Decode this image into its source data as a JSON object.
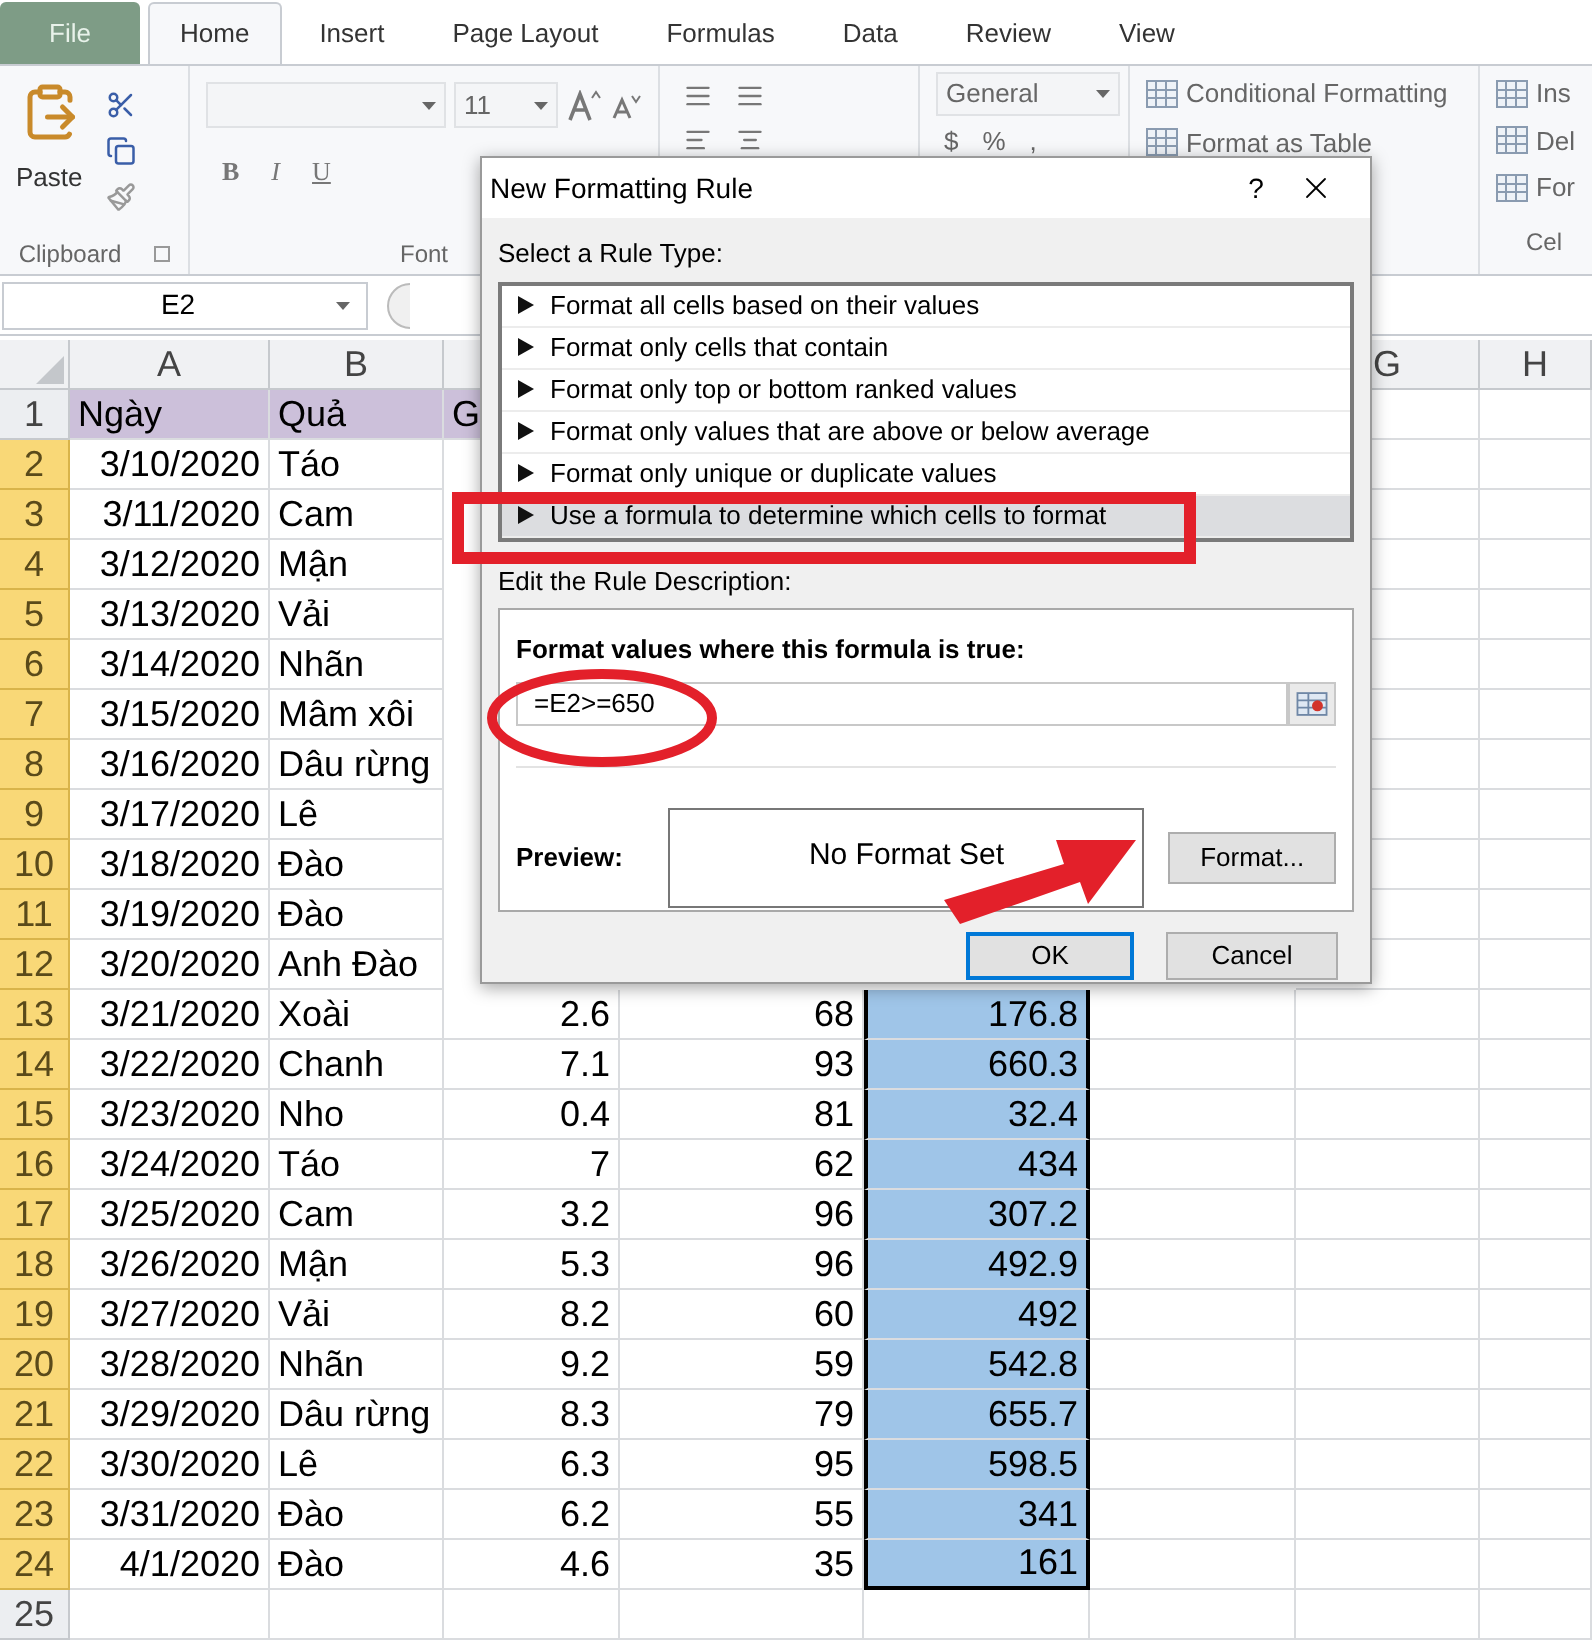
{
  "ribbon_tabs": [
    {
      "label": "File",
      "kind": "file",
      "selected": false
    },
    {
      "label": "Home",
      "kind": "tab",
      "selected": true
    },
    {
      "label": "Insert",
      "kind": "tab",
      "selected": false
    },
    {
      "label": "Page Layout",
      "kind": "tab",
      "selected": false
    },
    {
      "label": "Formulas",
      "kind": "tab",
      "selected": false
    },
    {
      "label": "Data",
      "kind": "tab",
      "selected": false
    },
    {
      "label": "Review",
      "kind": "tab",
      "selected": false
    },
    {
      "label": "View",
      "kind": "tab",
      "selected": false
    }
  ],
  "ribbon": {
    "clipboard": {
      "paste": "Paste",
      "group": "Clipboard"
    },
    "font": {
      "size": "11",
      "bold": "B",
      "italic": "I",
      "underline": "U",
      "group": "Font"
    },
    "number": {
      "format": "General",
      "currency": "$",
      "percent": "%",
      "comma": ","
    },
    "styles": {
      "conditional_formatting": "Conditional Formatting",
      "format_as_table": "Format as Table"
    },
    "cells": {
      "insert": "Ins",
      "delete": "Del",
      "format": "For",
      "group": "Cel"
    }
  },
  "name_box": "E2",
  "sheet": {
    "column_headers_left": [
      "A",
      "B"
    ],
    "column_headers_right": [
      "G",
      "H"
    ],
    "rows": [
      {
        "header": "1",
        "kind": "title",
        "selected": false,
        "cells": [
          "Ngày",
          "Quả",
          "G"
        ]
      },
      {
        "header": "2",
        "kind": "data",
        "selected": true,
        "cells": [
          "3/10/2020",
          "Táo"
        ]
      },
      {
        "header": "3",
        "kind": "data",
        "selected": true,
        "cells": [
          "3/11/2020",
          "Cam"
        ]
      },
      {
        "header": "4",
        "kind": "data",
        "selected": true,
        "cells": [
          "3/12/2020",
          "Mận"
        ]
      },
      {
        "header": "5",
        "kind": "data",
        "selected": true,
        "cells": [
          "3/13/2020",
          "Vải"
        ]
      },
      {
        "header": "6",
        "kind": "data",
        "selected": true,
        "cells": [
          "3/14/2020",
          "Nhãn"
        ]
      },
      {
        "header": "7",
        "kind": "data",
        "selected": true,
        "cells": [
          "3/15/2020",
          "Mâm xôi"
        ]
      },
      {
        "header": "8",
        "kind": "data",
        "selected": true,
        "cells": [
          "3/16/2020",
          "Dâu rừng"
        ]
      },
      {
        "header": "9",
        "kind": "data",
        "selected": true,
        "cells": [
          "3/17/2020",
          "Lê"
        ]
      },
      {
        "header": "10",
        "kind": "data",
        "selected": true,
        "cells": [
          "3/18/2020",
          "Đào"
        ]
      },
      {
        "header": "11",
        "kind": "data",
        "selected": true,
        "cells": [
          "3/19/2020",
          "Đào"
        ]
      },
      {
        "header": "12",
        "kind": "data",
        "selected": true,
        "cells": [
          "3/20/2020",
          "Anh Đào"
        ]
      },
      {
        "header": "13",
        "kind": "data",
        "selected": true,
        "cells": [
          "3/21/2020",
          "Xoài",
          "2.6",
          "68",
          "176.8"
        ]
      },
      {
        "header": "14",
        "kind": "data",
        "selected": true,
        "cells": [
          "3/22/2020",
          "Chanh",
          "7.1",
          "93",
          "660.3"
        ]
      },
      {
        "header": "15",
        "kind": "data",
        "selected": true,
        "cells": [
          "3/23/2020",
          "Nho",
          "0.4",
          "81",
          "32.4"
        ]
      },
      {
        "header": "16",
        "kind": "data",
        "selected": true,
        "cells": [
          "3/24/2020",
          "Táo",
          "7",
          "62",
          "434"
        ]
      },
      {
        "header": "17",
        "kind": "data",
        "selected": true,
        "cells": [
          "3/25/2020",
          "Cam",
          "3.2",
          "96",
          "307.2"
        ]
      },
      {
        "header": "18",
        "kind": "data",
        "selected": true,
        "cells": [
          "3/26/2020",
          "Mận",
          "5.3",
          "96",
          "492.9"
        ]
      },
      {
        "header": "19",
        "kind": "data",
        "selected": true,
        "cells": [
          "3/27/2020",
          "Vải",
          "8.2",
          "60",
          "492"
        ]
      },
      {
        "header": "20",
        "kind": "data",
        "selected": true,
        "cells": [
          "3/28/2020",
          "Nhãn",
          "9.2",
          "59",
          "542.8"
        ]
      },
      {
        "header": "21",
        "kind": "data",
        "selected": true,
        "cells": [
          "3/29/2020",
          "Dâu rừng",
          "8.3",
          "79",
          "655.7"
        ]
      },
      {
        "header": "22",
        "kind": "data",
        "selected": true,
        "cells": [
          "3/30/2020",
          "Lê",
          "6.3",
          "95",
          "598.5"
        ]
      },
      {
        "header": "23",
        "kind": "data",
        "selected": true,
        "cells": [
          "3/31/2020",
          "Đào",
          "6.2",
          "55",
          "341"
        ]
      },
      {
        "header": "24",
        "kind": "data",
        "selected": true,
        "cells": [
          "4/1/2020",
          "Đào",
          "4.6",
          "35",
          "161"
        ]
      },
      {
        "header": "25",
        "kind": "data",
        "selected": false
      }
    ]
  },
  "dialog": {
    "title": "New Formatting Rule",
    "help": "?",
    "rule_type_label": "Select a Rule Type:",
    "rule_types": [
      {
        "label": "Format all cells based on their values",
        "selected": false
      },
      {
        "label": "Format only cells that contain",
        "selected": false
      },
      {
        "label": "Format only top or bottom ranked values",
        "selected": false
      },
      {
        "label": "Format only values that are above or below average",
        "selected": false
      },
      {
        "label": "Format only unique or duplicate values",
        "selected": false
      },
      {
        "label": "Use a formula to determine which cells to format",
        "selected": true
      }
    ],
    "description_label": "Edit the Rule Description:",
    "formula_label": "Format values where this formula is true:",
    "formula": "=E2>=650",
    "preview_label": "Preview:",
    "preview": "No Format Set",
    "format_button": "Format...",
    "ok_button": "OK",
    "cancel_button": "Cancel"
  }
}
